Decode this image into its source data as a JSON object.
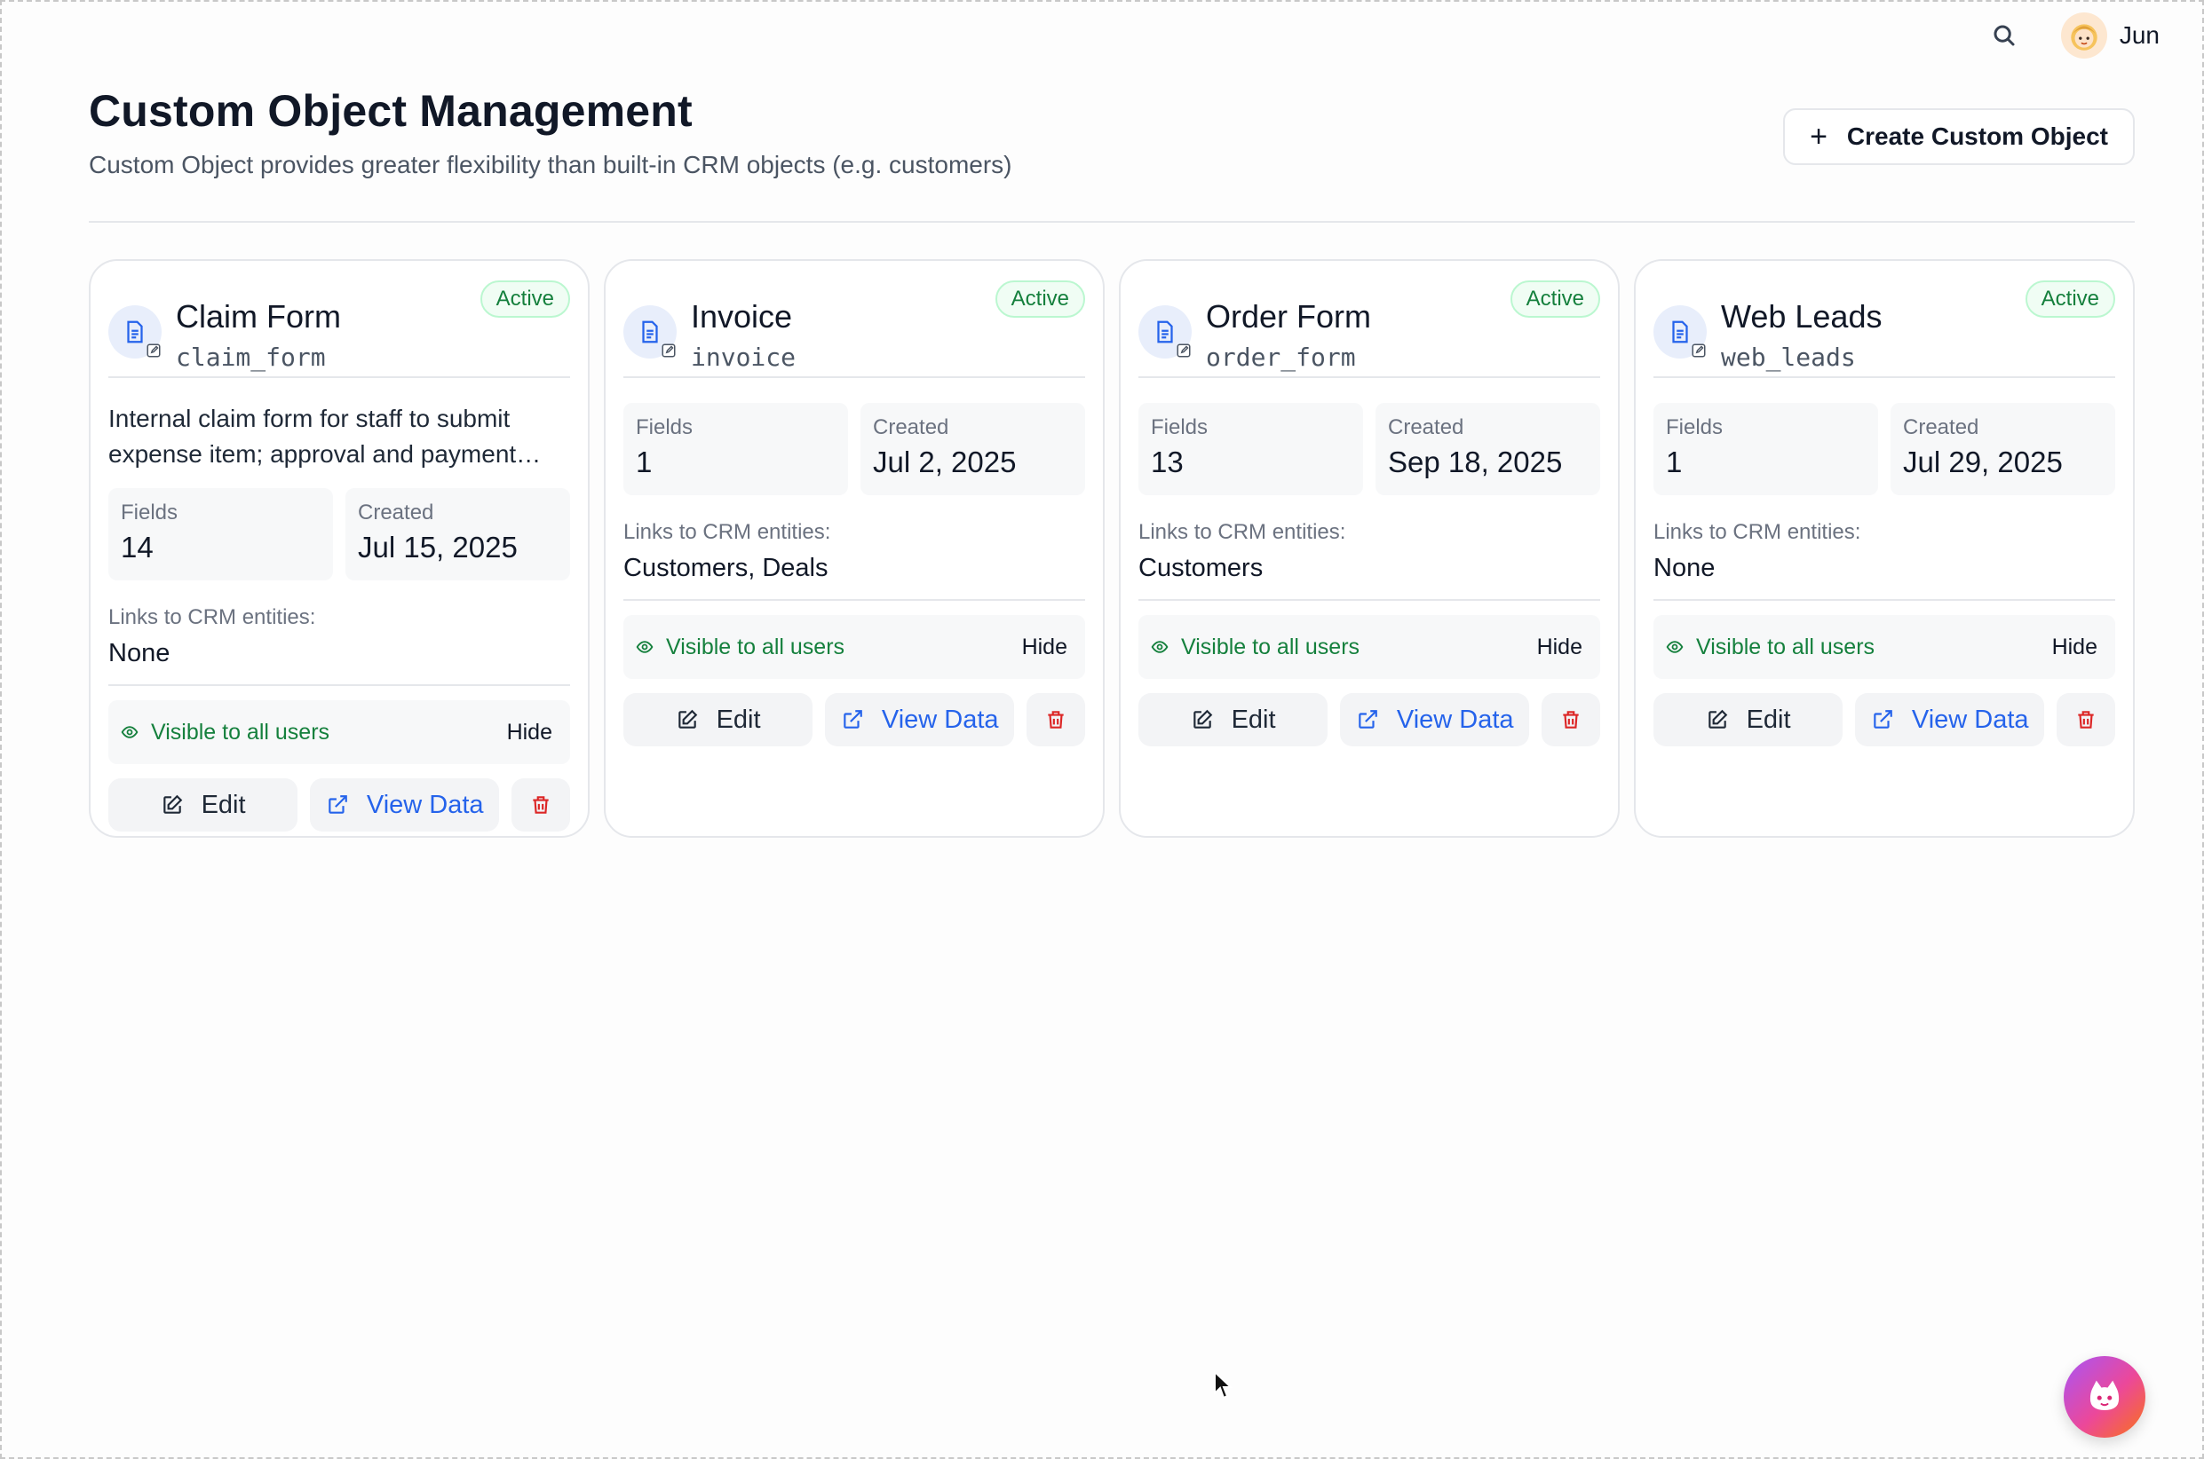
{
  "header": {
    "title": "Custom Object Management",
    "subtitle": "Custom Object provides greater flexibility than built-in CRM objects (e.g. customers)",
    "create_label": "Create Custom Object"
  },
  "user": {
    "name": "Jun"
  },
  "labels": {
    "fields": "Fields",
    "created": "Created",
    "links": "Links to CRM entities:",
    "visible": "Visible to all users",
    "hide": "Hide",
    "edit": "Edit",
    "view_data": "View Data"
  },
  "cards": [
    {
      "title": "Claim Form",
      "key": "claim_form",
      "status": "Active",
      "description": "Internal claim form for staff to submit expense item; approval and payment…",
      "fields": "14",
      "created": "Jul 15, 2025",
      "links": "None"
    },
    {
      "title": "Invoice",
      "key": "invoice",
      "status": "Active",
      "description": "",
      "fields": "1",
      "created": "Jul 2, 2025",
      "links": "Customers, Deals"
    },
    {
      "title": "Order Form",
      "key": "order_form",
      "status": "Active",
      "description": "",
      "fields": "13",
      "created": "Sep 18, 2025",
      "links": "Customers"
    },
    {
      "title": "Web Leads",
      "key": "web_leads",
      "status": "Active",
      "description": "",
      "fields": "1",
      "created": "Jul 29, 2025",
      "links": "None"
    }
  ],
  "icons": {
    "search": "search-icon",
    "object": "document-icon",
    "visible": "eye-icon",
    "edit": "pencil-square-icon",
    "view": "external-link-icon",
    "delete": "trash-icon",
    "assistant": "cat-face-icon"
  },
  "colors": {
    "active_badge": "#15803d",
    "view_link": "#2563eb",
    "delete": "#dc2626",
    "object_icon": "#2563eb"
  }
}
